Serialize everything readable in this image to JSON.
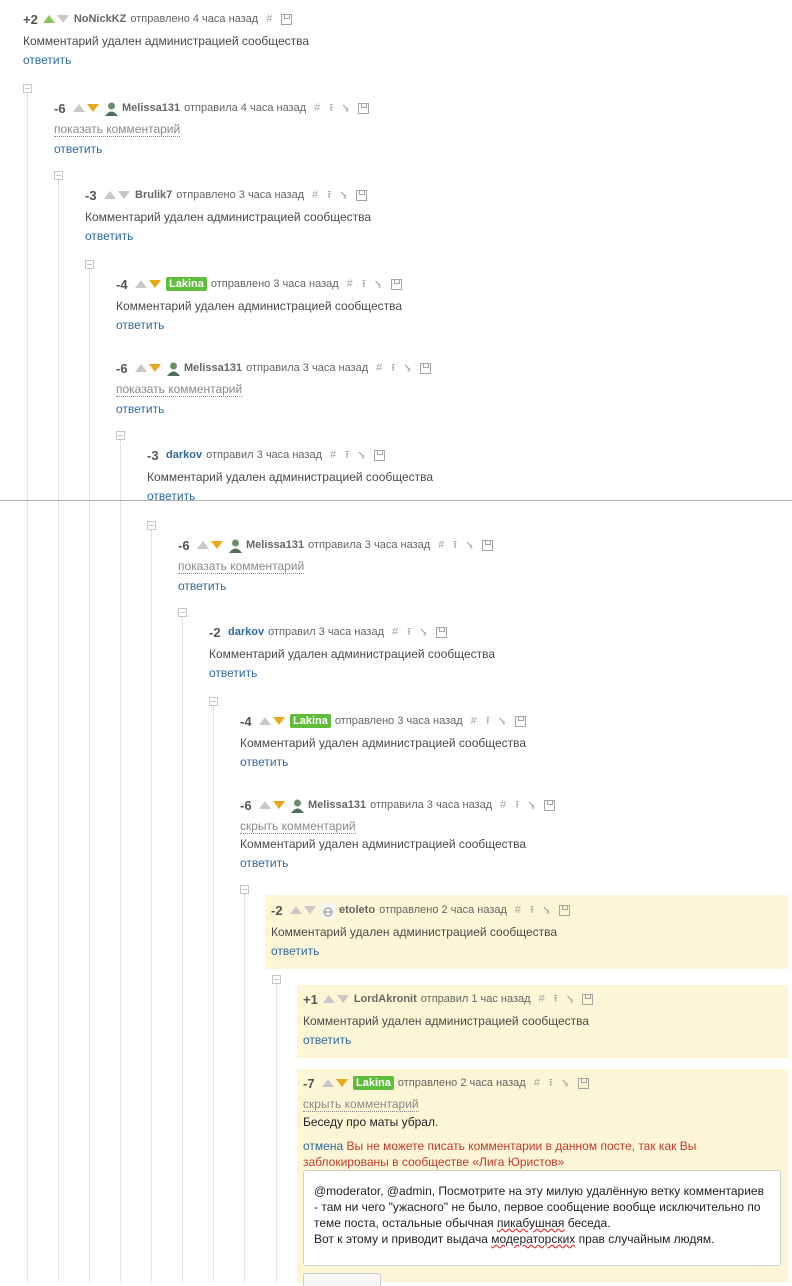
{
  "comments": [
    {
      "rating": "+2",
      "author": "NoNickKZ",
      "time": "отправлено 4 часа назад",
      "text": "Комментарий удален администрацией сообщества",
      "reply": "ответить"
    },
    {
      "rating": "-6",
      "author": "Melissa131",
      "time": "отправила 4 часа назад",
      "toggle": "показать комментарий",
      "reply": "ответить"
    },
    {
      "rating": "-3",
      "author": "Brulik7",
      "time": "отправлено 3 часа назад",
      "text": "Комментарий удален администрацией сообщества",
      "reply": "ответить"
    },
    {
      "rating": "-4",
      "author": "Lakina",
      "time": "отправлено 3 часа назад",
      "text": "Комментарий удален администрацией сообщества",
      "reply": "ответить"
    },
    {
      "rating": "-6",
      "author": "Melissa131",
      "time": "отправила 3 часа назад",
      "toggle": "показать комментарий",
      "reply": "ответить"
    },
    {
      "rating": "-3",
      "author": "darkov",
      "time": "отправил 3 часа назад",
      "text": "Комментарий удален администрацией сообщества",
      "reply": "ответить"
    },
    {
      "rating": "-6",
      "author": "Melissa131",
      "time": "отправила 3 часа назад",
      "toggle": "показать комментарий",
      "reply": "ответить"
    },
    {
      "rating": "-2",
      "author": "darkov",
      "time": "отправил 3 часа назад",
      "text": "Комментарий удален администрацией сообщества",
      "reply": "ответить"
    },
    {
      "rating": "-4",
      "author": "Lakina",
      "time": "отправлено 3 часа назад",
      "text": "Комментарий удален администрацией сообщества",
      "reply": "ответить"
    },
    {
      "rating": "-6",
      "author": "Melissa131",
      "time": "отправила 3 часа назад",
      "toggle": "скрыть комментарий",
      "text": "Комментарий удален администрацией сообщества",
      "reply": "ответить"
    },
    {
      "rating": "-2",
      "author": "etoleto",
      "time": "отправлено 2 часа назад",
      "text": "Комментарий удален администрацией сообщества",
      "reply": "ответить"
    },
    {
      "rating": "+1",
      "author": "LordAkronit",
      "time": "отправил 1 час назад",
      "text": "Комментарий удален администрацией сообщества",
      "reply": "ответить"
    },
    {
      "rating": "-7",
      "author": "Lakina",
      "time": "отправлено 2 часа назад",
      "toggle": "скрыть комментарий",
      "text": "Беседу про маты убрал."
    }
  ],
  "icons": {
    "link": "#",
    "parent": "⭱",
    "branch": "⭸",
    "save": "save-icon"
  },
  "blocked": {
    "cancel": "отмена",
    "message": "Вы не можете писать комментарии в данном посте, так как Вы заблокированы в сообществе «Лига Юристов»"
  },
  "editor": {
    "p1": "@moderator, @admin, Посмотрите на эту милую удалённую ветку комментариев - там ни чего \"ужасного\" не было, первое сообщение вообще исключительно по теме поста, остальные обычная ",
    "p2": "пикабушная",
    "p3": " беседа.",
    "p4": "Вот к этому и приводит выдача ",
    "p5": "модераторских",
    "p6": " прав случайным людям."
  },
  "colors": {
    "upvote": "#8ac858",
    "downvote": "#e8a81e",
    "badge": "#5fbd3c",
    "link": "#2d6a9f",
    "highlight": "#fdf6d6",
    "blocked": "#c0392b"
  }
}
